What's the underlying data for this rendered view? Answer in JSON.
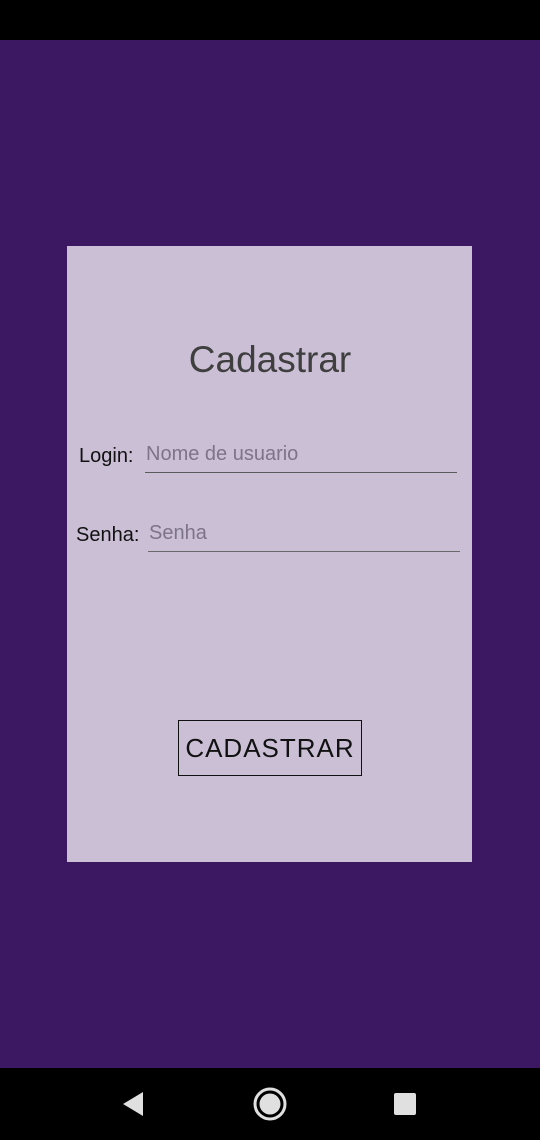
{
  "form": {
    "title": "Cadastrar",
    "login": {
      "label": "Login:",
      "placeholder": "Nome de usuario",
      "value": ""
    },
    "senha": {
      "label": "Senha:",
      "placeholder": "Senha",
      "value": ""
    },
    "submit_label": "CADASTRAR"
  },
  "nav_bar": {
    "back_icon": "back-triangle-icon",
    "home_icon": "home-circle-icon",
    "recents_icon": "recents-square-icon"
  },
  "colors": {
    "background": "#3d1862",
    "card": "#cbbfd6",
    "system_bars": "#000000"
  }
}
